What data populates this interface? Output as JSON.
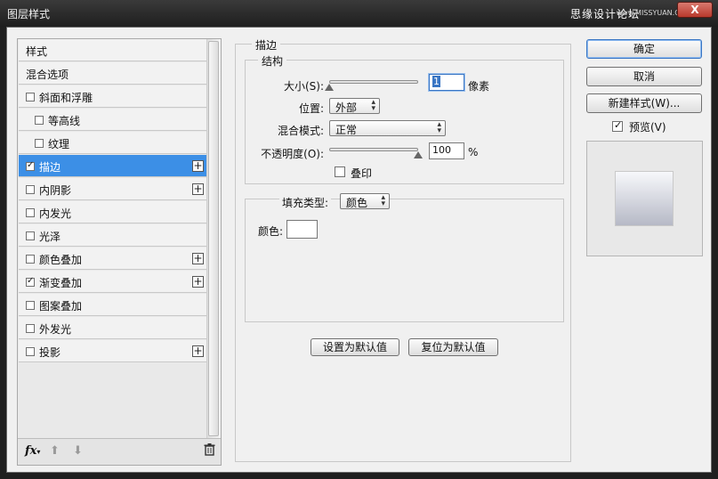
{
  "window": {
    "title": "图层样式",
    "watermark": "思缘设计论坛",
    "watermark_site": "www.MISSYUAN.COM",
    "close_label": "X"
  },
  "style_list": {
    "items": [
      {
        "label": "样式",
        "checkbox": false,
        "checked": false,
        "indent": false,
        "selected": false,
        "plus": false
      },
      {
        "label": "混合选项",
        "checkbox": false,
        "checked": false,
        "indent": false,
        "selected": false,
        "plus": false
      },
      {
        "label": "斜面和浮雕",
        "checkbox": true,
        "checked": false,
        "indent": false,
        "selected": false,
        "plus": false
      },
      {
        "label": "等高线",
        "checkbox": true,
        "checked": false,
        "indent": true,
        "selected": false,
        "plus": false
      },
      {
        "label": "纹理",
        "checkbox": true,
        "checked": false,
        "indent": true,
        "selected": false,
        "plus": false
      },
      {
        "label": "描边",
        "checkbox": true,
        "checked": true,
        "indent": false,
        "selected": true,
        "plus": true
      },
      {
        "label": "内阴影",
        "checkbox": true,
        "checked": false,
        "indent": false,
        "selected": false,
        "plus": true
      },
      {
        "label": "内发光",
        "checkbox": true,
        "checked": false,
        "indent": false,
        "selected": false,
        "plus": false
      },
      {
        "label": "光泽",
        "checkbox": true,
        "checked": false,
        "indent": false,
        "selected": false,
        "plus": false
      },
      {
        "label": "颜色叠加",
        "checkbox": true,
        "checked": false,
        "indent": false,
        "selected": false,
        "plus": true
      },
      {
        "label": "渐变叠加",
        "checkbox": true,
        "checked": true,
        "indent": false,
        "selected": false,
        "plus": true
      },
      {
        "label": "图案叠加",
        "checkbox": true,
        "checked": false,
        "indent": false,
        "selected": false,
        "plus": false
      },
      {
        "label": "外发光",
        "checkbox": true,
        "checked": false,
        "indent": false,
        "selected": false,
        "plus": false
      },
      {
        "label": "投影",
        "checkbox": true,
        "checked": false,
        "indent": false,
        "selected": false,
        "plus": true
      }
    ],
    "plus_glyph": "+",
    "check_glyph": "✓",
    "fx_label": "fx",
    "fx_sub": "▾",
    "up_arrow": "⬆",
    "down_arrow": "⬇",
    "trash_glyph": "🗑"
  },
  "stroke": {
    "title": "描边",
    "structure": {
      "title": "结构",
      "size_label": "大小(S):",
      "size_value": "1",
      "size_unit": "像素",
      "size_slider_fraction": 0.0,
      "position_label": "位置:",
      "position_value": "外部",
      "blend_label": "混合模式:",
      "blend_value": "正常",
      "opacity_label": "不透明度(O):",
      "opacity_value": "100",
      "opacity_unit": "%",
      "opacity_slider_fraction": 1.0,
      "overprint_label": "叠印",
      "overprint_checked": false
    },
    "fill": {
      "type_label": "填充类型:",
      "type_value": "颜色",
      "color_label": "颜色:",
      "color_value": "#ffffff"
    },
    "set_default_label": "设置为默认值",
    "reset_default_label": "复位为默认值"
  },
  "right": {
    "ok_label": "确定",
    "cancel_label": "取消",
    "new_style_label": "新建样式(W)...",
    "preview_label": "预览(V)",
    "preview_checked": true
  },
  "colors": {
    "selection": "#3c8fe6",
    "focus": "#3a76c4"
  }
}
